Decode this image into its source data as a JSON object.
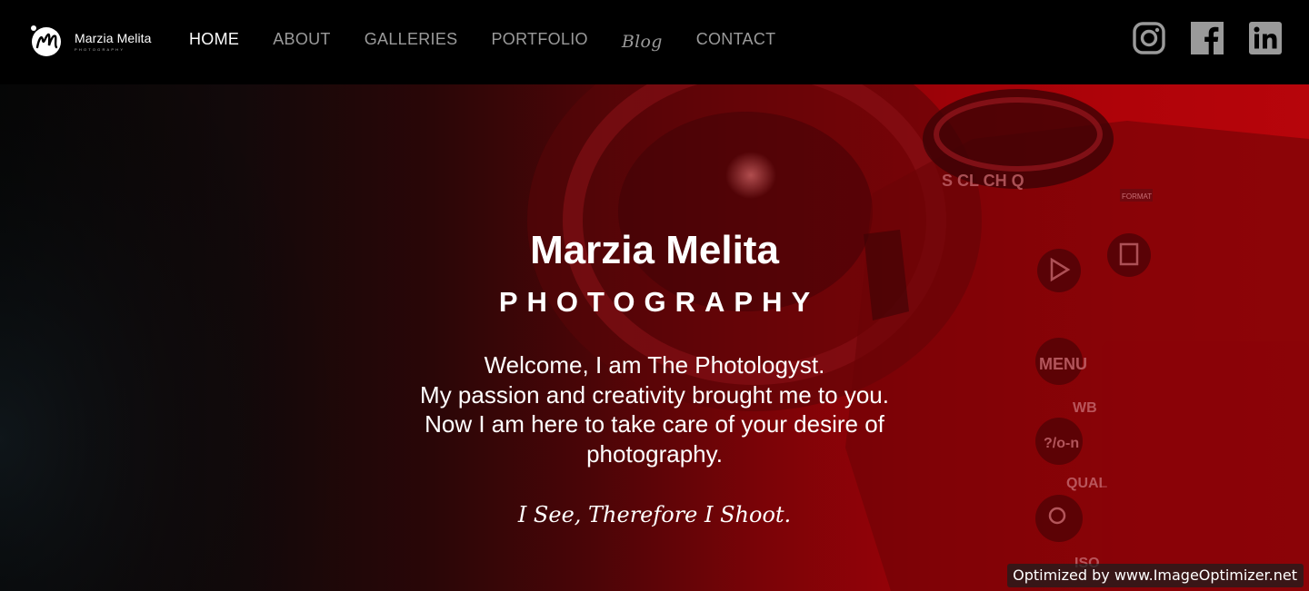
{
  "brand": {
    "name": "Marzia Melita",
    "sub": "PHOTOGRAPHY"
  },
  "nav": {
    "items": [
      {
        "label": "HOME",
        "active": true
      },
      {
        "label": "ABOUT",
        "active": false
      },
      {
        "label": "GALLERIES",
        "active": false
      },
      {
        "label": "PORTFOLIO",
        "active": false
      },
      {
        "label": "Blog",
        "active": false
      },
      {
        "label": "CONTACT",
        "active": false
      }
    ]
  },
  "social": [
    {
      "icon": "instagram-icon"
    },
    {
      "icon": "facebook-icon"
    },
    {
      "icon": "linkedin-icon"
    }
  ],
  "hero": {
    "title": "Marzia Melita",
    "subtitle": "PHOTOGRAPHY",
    "lines": [
      "Welcome, I am The Photologyst.",
      "My passion and creativity brought me to you.",
      "Now I am here to take care of your desire of",
      "photography."
    ],
    "motto": "I See, Therefore I Shoot."
  },
  "camera_labels": {
    "dial": "S CL CH Q",
    "menu": "MENU",
    "wb": "WB",
    "key": "?/o-n",
    "qual": "QUAL",
    "iso": "ISO",
    "format": "FORMAT"
  },
  "watermark": "Optimized by www.ImageOptimizer.net",
  "colors": {
    "nav_bg": "#000000",
    "hero_red": "#b00309",
    "menu_inactive": "#9a9a9a",
    "menu_active": "#ffffff"
  }
}
